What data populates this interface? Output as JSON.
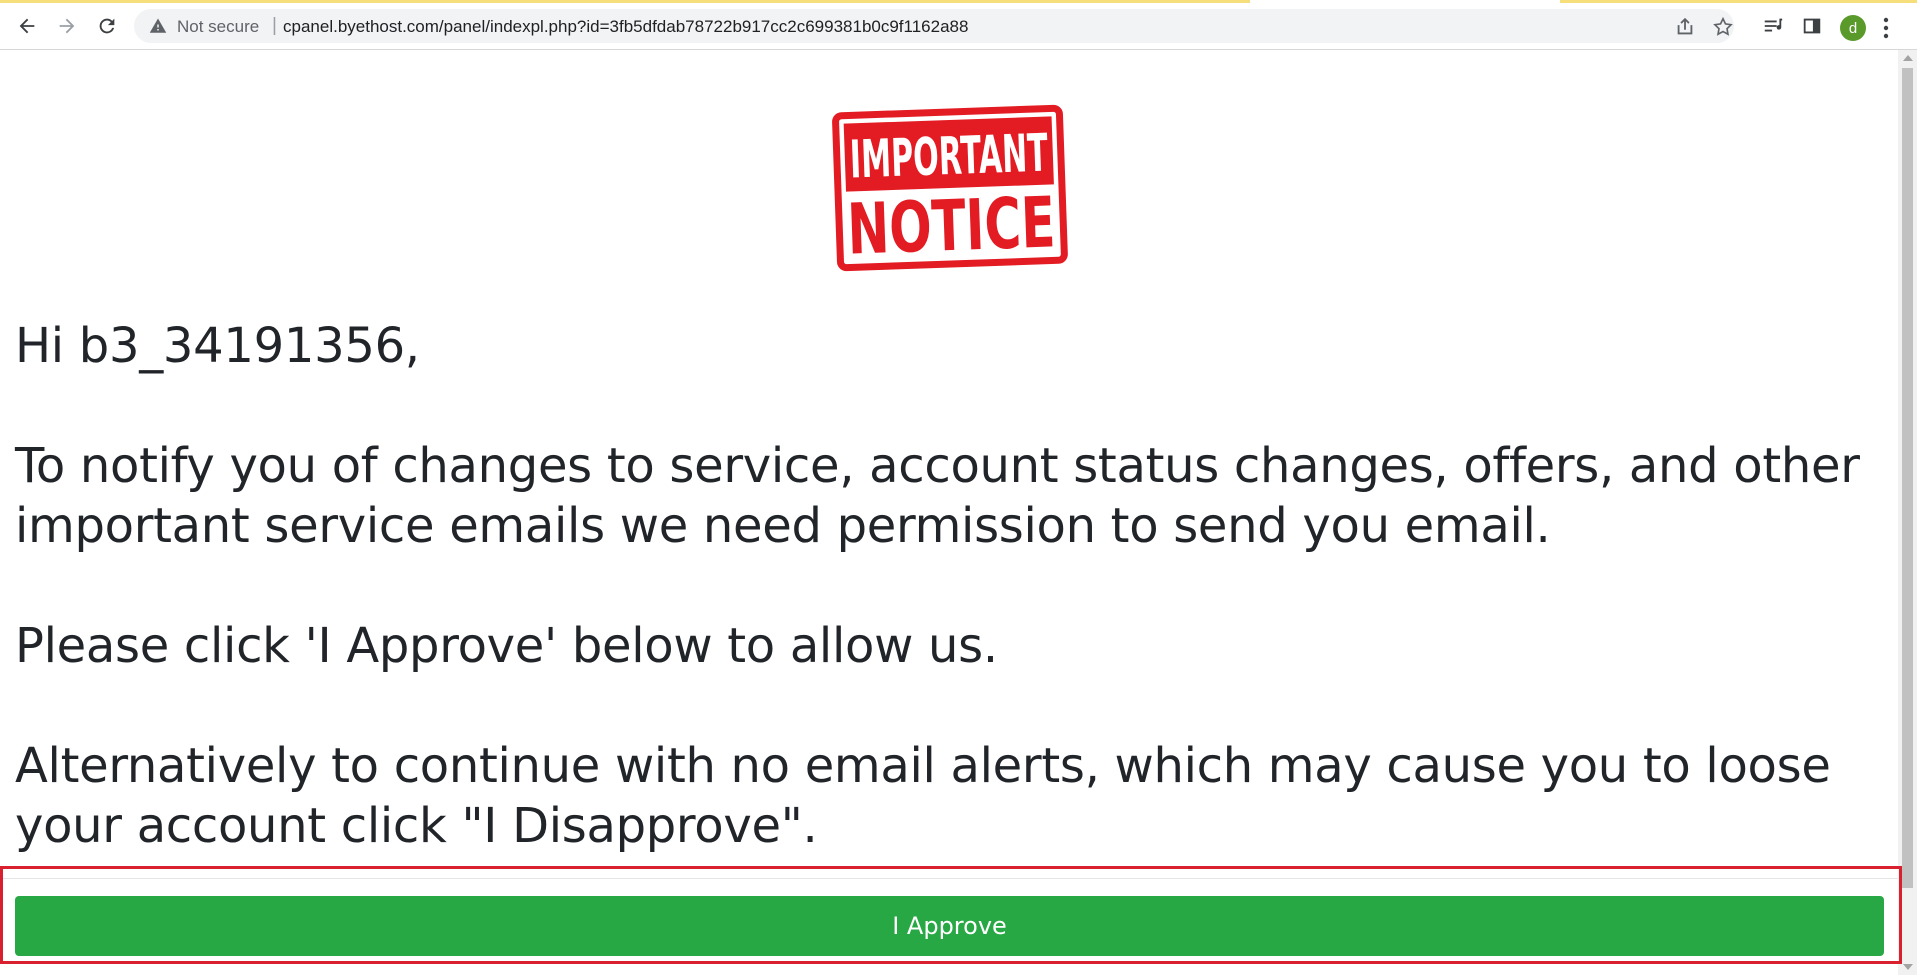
{
  "browser": {
    "security_label": "Not secure",
    "separator": "|",
    "url": "cpanel.byethost.com/panel/indexpl.php?id=3fb5dfdab78722b917cc2c699381b0c9f1162a88",
    "profile_initial": "d",
    "icons": {
      "back": "back-arrow-icon",
      "forward": "forward-arrow-icon",
      "reload": "reload-icon",
      "warning": "warning-triangle-icon",
      "share": "share-icon",
      "bookmark": "star-icon",
      "reading_list": "reading-list-icon",
      "side_panel": "side-panel-icon",
      "menu": "kebab-menu-icon"
    },
    "colors": {
      "avatar": "#5a9a2a"
    }
  },
  "page": {
    "stamp": {
      "line1": "IMPORTANT",
      "line2": "NOTICE",
      "color": "#e31b23"
    },
    "greeting": "Hi b3_34191356,",
    "paragraph1": "To notify you of changes to service, account status changes, offers, and other important service emails we need permission to send you email.",
    "paragraph2": "Please click 'I Approve' below to allow us.",
    "paragraph3": "Alternatively to continue with no email alerts, which may cause you to loose your account click \"I Disapprove\".",
    "approve_button": "I Approve",
    "colors": {
      "button": "#28a745",
      "highlight": "#d8202f",
      "text": "#212529"
    }
  }
}
